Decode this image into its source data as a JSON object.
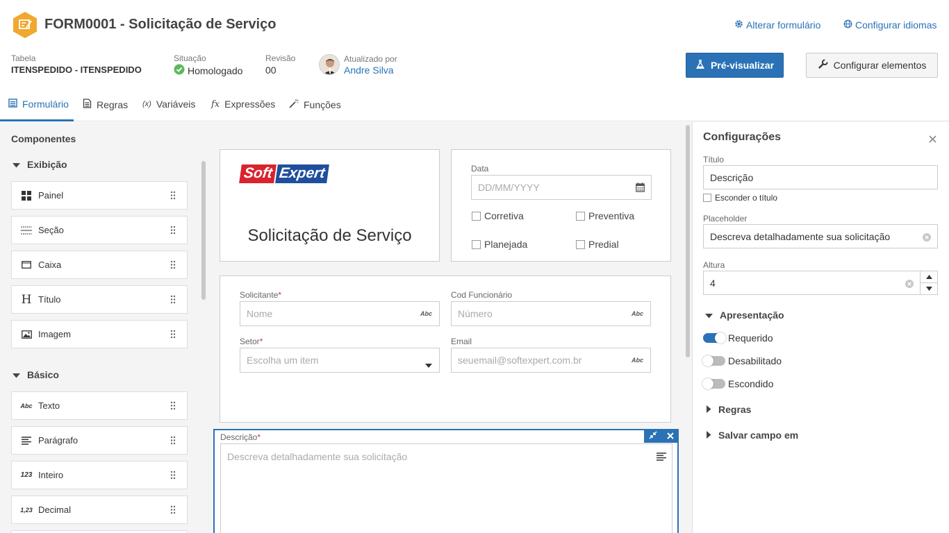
{
  "header": {
    "form_title": "FORM0001 - Solicitação de Serviço",
    "change_form_link": "Alterar formulário",
    "configure_languages_link": "Configurar idiomas",
    "table_label": "Tabela",
    "table_value": "ITENSPEDIDO - ITENSPEDIDO",
    "status_label": "Situação",
    "status_value": "Homologado",
    "revision_label": "Revisão",
    "revision_value": "00",
    "updated_by_label": "Atualizado por",
    "updated_by_value": "Andre Silva",
    "preview_button": "Pré-visualizar",
    "configure_elements_button": "Configurar elementos"
  },
  "tabs": [
    {
      "label": "Formulário",
      "icon": "form-icon",
      "active": true
    },
    {
      "label": "Regras",
      "icon": "rules-icon"
    },
    {
      "label": "Variáveis",
      "icon": "variables-icon"
    },
    {
      "label": "Expressões",
      "icon": "function-icon"
    },
    {
      "label": "Funções",
      "icon": "magic-wand-icon"
    }
  ],
  "components": {
    "title": "Componentes",
    "groups": [
      {
        "label": "Exibição",
        "items": [
          {
            "label": "Painel",
            "icon": "panel-icon"
          },
          {
            "label": "Seção",
            "icon": "section-icon"
          },
          {
            "label": "Caixa",
            "icon": "box-icon"
          },
          {
            "label": "Título",
            "icon": "heading-icon",
            "glyph": "H"
          },
          {
            "label": "Imagem",
            "icon": "image-icon"
          }
        ]
      },
      {
        "label": "Básico",
        "items": [
          {
            "label": "Texto",
            "icon": "text-icon",
            "glyph": "Abc"
          },
          {
            "label": "Parágrafo",
            "icon": "paragraph-icon"
          },
          {
            "label": "Inteiro",
            "icon": "integer-icon",
            "glyph": "123"
          },
          {
            "label": "Decimal",
            "icon": "decimal-icon",
            "glyph": "1,23"
          }
        ]
      }
    ]
  },
  "canvas": {
    "logo_soft": "Soft",
    "logo_expert": "Expert",
    "form_heading": "Solicitação de Serviço",
    "date": {
      "label": "Data",
      "placeholder": "DD/MM/YYYY"
    },
    "checkboxes": [
      "Corretiva",
      "Preventiva",
      "Planejada",
      "Predial"
    ],
    "requester": {
      "label": "Solicitante",
      "placeholder": "Nome"
    },
    "employee_code": {
      "label": "Cod Funcionário",
      "placeholder": "Número"
    },
    "sector": {
      "label": "Setor",
      "placeholder": "Escolha um item"
    },
    "email": {
      "label": "Email",
      "placeholder": "seuemail@softexpert.com.br"
    },
    "description": {
      "label": "Descrição",
      "placeholder": "Descreva detalhadamente sua solicitação"
    },
    "abc_badge": "Abc",
    "required_mark": "*"
  },
  "settings": {
    "title": "Configurações",
    "title_label": "Título",
    "title_value": "Descrição",
    "hide_title_label": "Esconder o título",
    "placeholder_label": "Placeholder",
    "placeholder_value": "Descreva detalhadamente sua solicitação",
    "height_label": "Altura",
    "height_value": "4",
    "presentation_label": "Apresentação",
    "toggles": [
      {
        "label": "Requerido",
        "on": true
      },
      {
        "label": "Desabilitado",
        "on": false
      },
      {
        "label": "Escondido",
        "on": false
      }
    ],
    "rules_label": "Regras",
    "save_field_label": "Salvar campo em"
  },
  "colors": {
    "accent": "#2a72b5",
    "status_green": "#5cb85c",
    "hex_orange": "#f0a830",
    "logo_red": "#d9232d",
    "logo_blue": "#1f4e9c"
  }
}
